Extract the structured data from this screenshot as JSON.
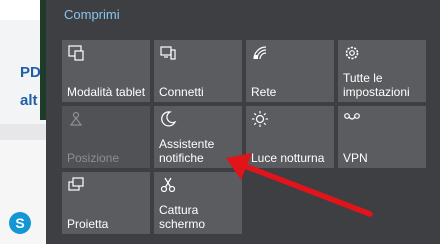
{
  "background": {
    "snippets": [
      "PD",
      "alt"
    ]
  },
  "panel": {
    "title": "Comprimi",
    "tiles": [
      {
        "label": "Modalità tablet",
        "icon": "tablet-mode-icon",
        "disabled": false
      },
      {
        "label": "Connetti",
        "icon": "connect-icon",
        "disabled": false
      },
      {
        "label": "Rete",
        "icon": "network-icon",
        "disabled": false
      },
      {
        "label": "Tutte le impostazioni",
        "icon": "settings-gear-icon",
        "disabled": false
      },
      {
        "label": "Posizione",
        "icon": "location-icon",
        "disabled": true
      },
      {
        "label": "Assistente notifiche",
        "icon": "moon-icon",
        "disabled": false
      },
      {
        "label": "Luce notturna",
        "icon": "brightness-icon",
        "disabled": false
      },
      {
        "label": "VPN",
        "icon": "vpn-icon",
        "disabled": false
      },
      {
        "label": "Proietta",
        "icon": "project-icon",
        "disabled": false
      },
      {
        "label": "Cattura schermo",
        "icon": "screen-snip-icon",
        "disabled": false
      }
    ]
  },
  "taskbar": {
    "skype_glyph": "S"
  },
  "colors": {
    "panel_bg": "#3d3f43",
    "tile_bg": "#5a5c5f",
    "title_color": "#8cc4f0",
    "annotation_arrow": "#e0141a"
  }
}
